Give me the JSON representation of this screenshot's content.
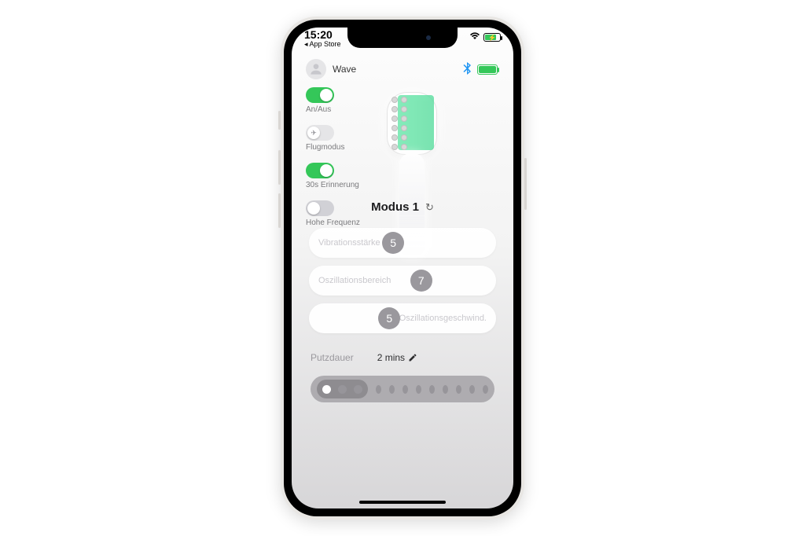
{
  "status": {
    "time": "15:20",
    "back": "◂ App Store"
  },
  "header": {
    "brand": "Wave",
    "bluetooth": "✱"
  },
  "toggles": {
    "power": {
      "label": "An/Aus",
      "on": true
    },
    "airplane": {
      "label": "Flugmodus",
      "on": false,
      "icon": "✈"
    },
    "reminder": {
      "label": "30s Erinnerung",
      "on": true
    },
    "highfreq": {
      "label": "Hohe Frequenz",
      "on": false
    }
  },
  "mode": {
    "label": "Modus 1",
    "refresh": "↻"
  },
  "sliders": {
    "vibration": {
      "label": "Vibrationsstärke",
      "value": "5"
    },
    "oscRange": {
      "label": "Oszillationsbereich",
      "value": "7"
    },
    "oscSpeed": {
      "label": "Oszillationsgeschwind.",
      "value": "5"
    }
  },
  "duration": {
    "label": "Putzdauer",
    "value": "2 mins"
  }
}
